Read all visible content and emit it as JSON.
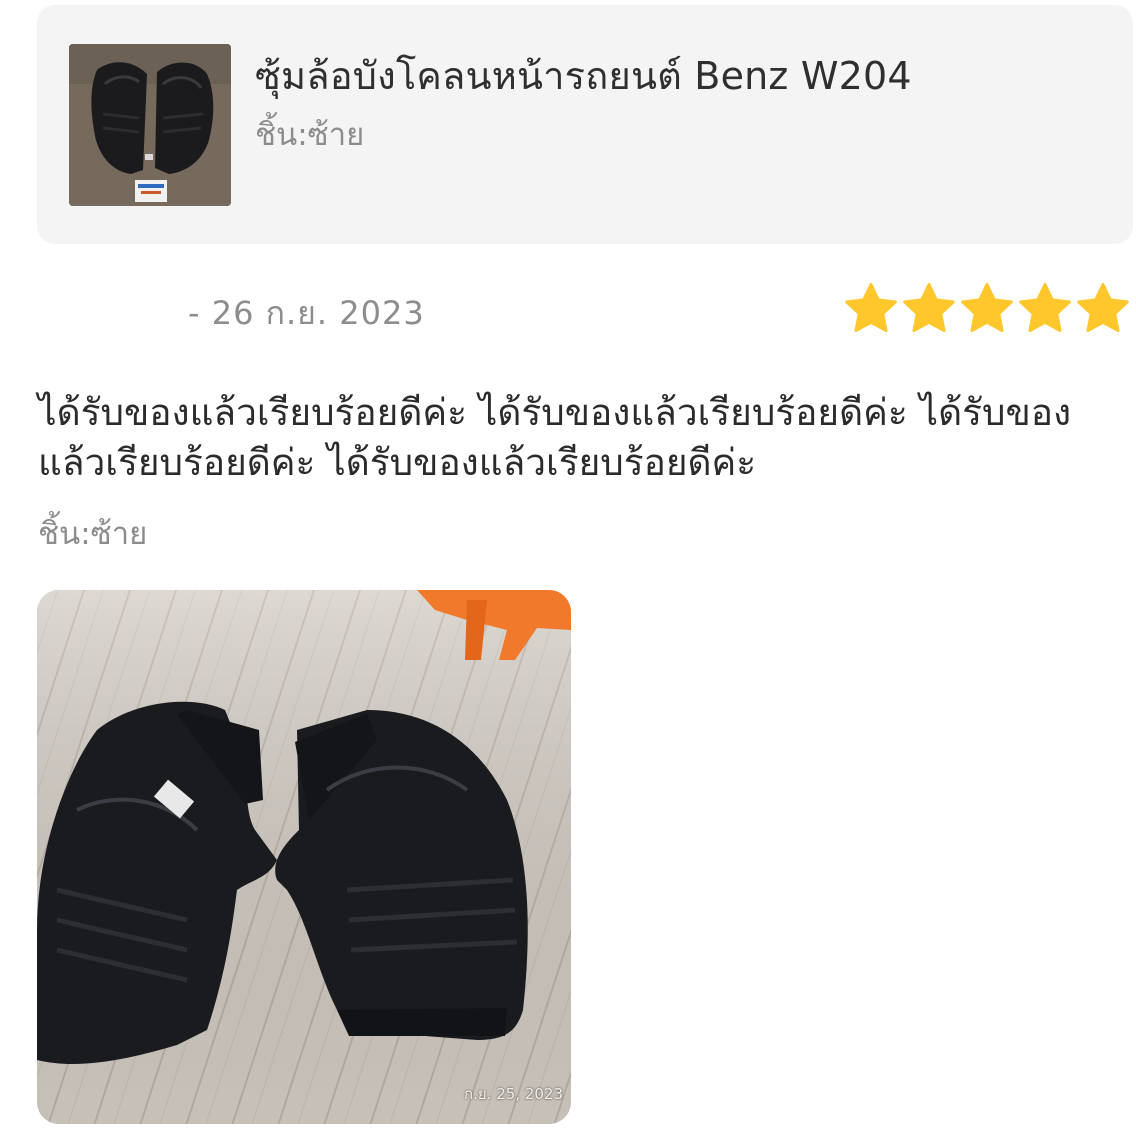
{
  "product": {
    "title": "ซุ้มล้อบังโคลนหน้ารถยนต์ Benz W204",
    "variant": "ชิ้น:ซ้าย",
    "thumbnail_icon": "fender-liner-product-thumbnail"
  },
  "review": {
    "date": "- 26 ก.ย. 2023",
    "rating": 5,
    "rating_max": 5,
    "star_color": "#FFC72C",
    "text": "ได้รับของแล้วเรียบร้อยดีค่ะ ได้รับของแล้วเรียบร้อยดีค่ะ ได้รับของแล้วเรียบร้อยดีค่ะ ได้รับของแล้วเรียบร้อยดีค่ะ",
    "variant": "ชิ้น:ซ้าย",
    "photo": {
      "icon": "fender-liner-review-photo",
      "stamp": "ก.ย. 25, 2023"
    }
  },
  "colors": {
    "card_background": "#F4F4F4",
    "muted_text": "#8C8C8C",
    "body_text": "#2B2B2B"
  }
}
